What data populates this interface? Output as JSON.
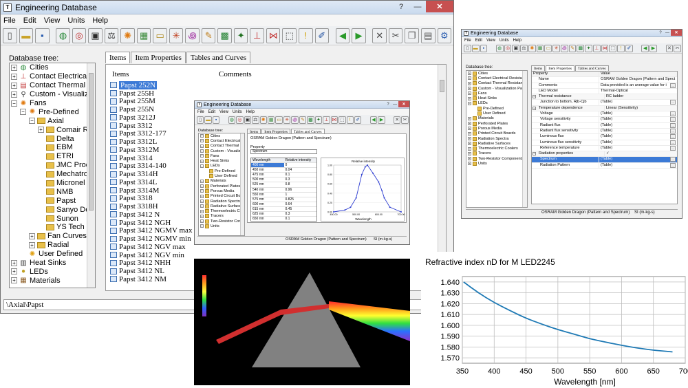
{
  "app": {
    "title": "Engineering Database",
    "menu": [
      "File",
      "Edit",
      "View",
      "Units",
      "Help"
    ],
    "window_controls": [
      "?",
      "—",
      "✕"
    ],
    "toolbar_icons": [
      "new-icon",
      "folder-icon",
      "save-icon",
      "globe-icon",
      "target-icon",
      "screen-icon",
      "scale-icon",
      "gear-icon",
      "grid-icon",
      "plate-icon",
      "network-icon",
      "spiral-icon",
      "tracer-icon",
      "pcb-icon",
      "tree-icon",
      "resistor-icon",
      "wing-icon",
      "chart-icon",
      "warning-icon",
      "edit-icon",
      "arrow-left-icon",
      "arrow-right-icon",
      "cross-icon",
      "scissors-icon",
      "copy-icon",
      "paste-icon",
      "settings-icon"
    ]
  },
  "main_window": {
    "tree_label": "Database tree:",
    "tabs": [
      "Items",
      "Item Properties",
      "Tables and Curves"
    ],
    "active_tab": 0,
    "tree": [
      {
        "label": "Cities",
        "level": 0,
        "exp": "+",
        "icon": "globe-icon"
      },
      {
        "label": "Contact Electrical Resis",
        "level": 0,
        "exp": "+",
        "icon": "contact-electrical-icon"
      },
      {
        "label": "Contact Thermal Resist",
        "level": 0,
        "exp": "+",
        "icon": "contact-thermal-icon"
      },
      {
        "label": "Custom - Visualization P",
        "level": 0,
        "exp": "+",
        "icon": "visualization-icon"
      },
      {
        "label": "Fans",
        "level": 0,
        "exp": "−",
        "icon": "fan-icon"
      },
      {
        "label": "Pre-Defined",
        "level": 1,
        "exp": "−",
        "icon": "predefined-icon"
      },
      {
        "label": "Axial",
        "level": 2,
        "exp": "−",
        "icon": "folder-icon"
      },
      {
        "label": "Comair Rot",
        "level": 3,
        "exp": "+",
        "icon": "folder-icon"
      },
      {
        "label": "Delta",
        "level": 3,
        "exp": "",
        "icon": "folder-icon"
      },
      {
        "label": "EBM",
        "level": 3,
        "exp": "",
        "icon": "folder-icon"
      },
      {
        "label": "ETRI",
        "level": 3,
        "exp": "",
        "icon": "folder-icon"
      },
      {
        "label": "JMC Produ",
        "level": 3,
        "exp": "",
        "icon": "folder-icon"
      },
      {
        "label": "Mechatroni",
        "level": 3,
        "exp": "",
        "icon": "folder-icon"
      },
      {
        "label": "Micronel",
        "level": 3,
        "exp": "",
        "icon": "folder-icon"
      },
      {
        "label": "NMB",
        "level": 3,
        "exp": "",
        "icon": "folder-icon"
      },
      {
        "label": "Papst",
        "level": 3,
        "exp": "",
        "icon": "folder-icon"
      },
      {
        "label": "Sanyo Den",
        "level": 3,
        "exp": "",
        "icon": "folder-icon"
      },
      {
        "label": "Sunon",
        "level": 3,
        "exp": "",
        "icon": "folder-icon"
      },
      {
        "label": "YS Tech U",
        "level": 3,
        "exp": "",
        "icon": "folder-icon"
      },
      {
        "label": "Fan Curves",
        "level": 2,
        "exp": "+",
        "icon": "folder-icon"
      },
      {
        "label": "Radial",
        "level": 2,
        "exp": "+",
        "icon": "folder-icon"
      },
      {
        "label": "User Defined",
        "level": 1,
        "exp": "",
        "icon": "user-defined-icon"
      },
      {
        "label": "Heat Sinks",
        "level": 0,
        "exp": "+",
        "icon": "heatsink-icon"
      },
      {
        "label": "LEDs",
        "level": 0,
        "exp": "+",
        "icon": "led-icon"
      },
      {
        "label": "Materials",
        "level": 0,
        "exp": "+",
        "icon": "materials-icon"
      }
    ],
    "list_headers": [
      "Items",
      "Comments"
    ],
    "items": [
      "Papst 252N",
      "Papst 255H",
      "Papst 255M",
      "Papst 255N",
      "Papst 3212J",
      "Papst 3312",
      "Papst 3312-177",
      "Papst 3312L",
      "Papst 3312M",
      "Papst 3314",
      "Papst 3314-140",
      "Papst 3314H",
      "Papst 3314L",
      "Papst 3314M",
      "Papst 3318",
      "Papst 3318H",
      "Papst 3412 N",
      "Papst 3412 NGH",
      "Papst 3412 NGMV max",
      "Papst 3412 NGMV min",
      "Papst 3412 NGV max",
      "Papst 3412 NGV min",
      "Papst 3412 NHH",
      "Papst 3412 NL",
      "Papst 3412 NM"
    ],
    "selected_item": 0,
    "status": "\\Axial\\Papst"
  },
  "tables_window": {
    "tree_label": "Database tree:",
    "tabs": [
      "Items",
      "Item Properties",
      "Tables and Curves"
    ],
    "active_tab": 2,
    "tree": [
      {
        "label": "Cities",
        "level": 0,
        "exp": "+"
      },
      {
        "label": "Contact Electrical Resistance",
        "level": 0,
        "exp": "+"
      },
      {
        "label": "Contact Thermal Resistance",
        "level": 0,
        "exp": "+"
      },
      {
        "label": "Custom - Visualization Para",
        "level": 0,
        "exp": "+"
      },
      {
        "label": "Fans",
        "level": 0,
        "exp": "+"
      },
      {
        "label": "Heat Sinks",
        "level": 0,
        "exp": "+"
      },
      {
        "label": "LEDs",
        "level": 0,
        "exp": "−"
      },
      {
        "label": "Pre-Defined",
        "level": 1,
        "exp": ""
      },
      {
        "label": "User Defined",
        "level": 1,
        "exp": ""
      },
      {
        "label": "Materials",
        "level": 0,
        "exp": "+"
      },
      {
        "label": "Perforated Plates",
        "level": 0,
        "exp": "+"
      },
      {
        "label": "Porous Media",
        "level": 0,
        "exp": "+"
      },
      {
        "label": "Printed Circuit Boards",
        "level": 0,
        "exp": "+"
      },
      {
        "label": "Radiation Spectra",
        "level": 0,
        "exp": "+"
      },
      {
        "label": "Radiative Surfaces",
        "level": 0,
        "exp": "+"
      },
      {
        "label": "Thermoelectric Coolers",
        "level": 0,
        "exp": "+"
      },
      {
        "label": "Tracers",
        "level": 0,
        "exp": "+"
      },
      {
        "label": "Two-Resistor Components",
        "level": 0,
        "exp": "+"
      },
      {
        "label": "Units",
        "level": 0,
        "exp": "+"
      }
    ],
    "panel_title": "OSRAM Golden Dragon (Pattern and Spectrum)",
    "property_label": "Property",
    "property_value": "Spectrum",
    "table_headers": [
      "Wavelength",
      "Relative intensity"
    ],
    "table_rows": [
      [
        "400 nm",
        "0"
      ],
      [
        "450 nm",
        "0.04"
      ],
      [
        "475 nm",
        "0.1"
      ],
      [
        "500 nm",
        "0.3"
      ],
      [
        "525 nm",
        "0.8"
      ],
      [
        "540 nm",
        "0.96"
      ],
      [
        "550 nm",
        "1"
      ],
      [
        "575 nm",
        "0.825"
      ],
      [
        "600 nm",
        "0.64"
      ],
      [
        "615 nm",
        "0.45"
      ],
      [
        "625 nm",
        "0.3"
      ],
      [
        "650 nm",
        "0.1"
      ],
      [
        "700 nm",
        "0"
      ]
    ],
    "selected_row": 0,
    "chart_title": "Relative intensity",
    "chart_xlabel": "Wavelength",
    "chart_yticks": [
      "1.00",
      "0.80",
      "0.60",
      "0.40",
      "0.20",
      "0.00"
    ],
    "chart_xticks": [
      "400.00",
      "500.00",
      "600.00",
      "700.00"
    ],
    "status_name": "OSRAM Golden Dragon (Pattern and Spectrum)",
    "status_units": "SI (m-kg-s)"
  },
  "props_window": {
    "tree_label": "Database tree:",
    "tabs": [
      "Items",
      "Item Properties",
      "Tables and Curves"
    ],
    "active_tab": 1,
    "tree": [
      {
        "label": "Cities",
        "level": 0,
        "exp": "+"
      },
      {
        "label": "Contact Electrical Resistance",
        "level": 0,
        "exp": "+"
      },
      {
        "label": "Contact Thermal Resistance",
        "level": 0,
        "exp": "+"
      },
      {
        "label": "Custom - Visualization Para",
        "level": 0,
        "exp": "+"
      },
      {
        "label": "Fans",
        "level": 0,
        "exp": "+"
      },
      {
        "label": "Heat Sinks",
        "level": 0,
        "exp": "+"
      },
      {
        "label": "LEDs",
        "level": 0,
        "exp": "−"
      },
      {
        "label": "Pre-Defined",
        "level": 1,
        "exp": ""
      },
      {
        "label": "User Defined",
        "level": 1,
        "exp": ""
      },
      {
        "label": "Materials",
        "level": 0,
        "exp": "+"
      },
      {
        "label": "Perforated Plates",
        "level": 0,
        "exp": "+"
      },
      {
        "label": "Porous Media",
        "level": 0,
        "exp": "+"
      },
      {
        "label": "Printed Circuit Boards",
        "level": 0,
        "exp": "+"
      },
      {
        "label": "Radiation Spectra",
        "level": 0,
        "exp": "+"
      },
      {
        "label": "Radiative Surfaces",
        "level": 0,
        "exp": "+"
      },
      {
        "label": "Thermoelectric Coolers",
        "level": 0,
        "exp": "+"
      },
      {
        "label": "Tracers",
        "level": 0,
        "exp": "+"
      },
      {
        "label": "Two-Resistor Components",
        "level": 0,
        "exp": "+"
      },
      {
        "label": "Units",
        "level": 0,
        "exp": "+"
      }
    ],
    "headers": [
      "Property",
      "Value"
    ],
    "rows": [
      {
        "name": "Name",
        "value": "OSRAM Golden Dragon (Pattern and Spect",
        "kind": "plain",
        "dots": false
      },
      {
        "name": "Comments",
        "value": "Data provided is an average value for i",
        "kind": "plain",
        "dots": true
      },
      {
        "name": "LED Model",
        "value": "Thermal-Optical",
        "kind": "plain",
        "dots": false
      },
      {
        "name": "Thermal resistance",
        "value": "RC ladder",
        "kind": "cat",
        "dots": false
      },
      {
        "name": "Junction to bottom, Rjb-Cjb",
        "value": "(Table)",
        "kind": "sub",
        "dots": true
      },
      {
        "name": "Temperature dependence",
        "value": "Linear (Sensitivity)",
        "kind": "cat",
        "dots": false
      },
      {
        "name": "Voltage",
        "value": "(Table)",
        "kind": "sub",
        "dots": true
      },
      {
        "name": "Voltage sensitivity",
        "value": "(Table)",
        "kind": "sub",
        "dots": true
      },
      {
        "name": "Radiant flux",
        "value": "(Table)",
        "kind": "sub",
        "dots": true
      },
      {
        "name": "Radiant flux sensitivity",
        "value": "(Table)",
        "kind": "sub",
        "dots": true
      },
      {
        "name": "Luminous flux",
        "value": "(Table)",
        "kind": "sub",
        "dots": true
      },
      {
        "name": "Luminous flux sensitivity",
        "value": "(Table)",
        "kind": "sub",
        "dots": true
      },
      {
        "name": "Reference temperature",
        "value": "(Table)",
        "kind": "sub",
        "dots": true
      },
      {
        "name": "Radiation properties",
        "value": "✓",
        "kind": "cat",
        "dots": false
      },
      {
        "name": "Spectrum",
        "value": "(Table)",
        "kind": "sel",
        "dots": true
      },
      {
        "name": "Radiation Pattern",
        "value": "(Table)",
        "kind": "sub",
        "dots": true
      }
    ],
    "status_name": "OSRAM Golden Dragon (Pattern and Spectrum)",
    "status_units": "SI (m-kg-s)"
  },
  "chart_data": {
    "type": "line",
    "title": "Refractive index nD for M LED2245",
    "xlabel": "Wavelength [nm]",
    "ylabel": "",
    "xlim": [
      350,
      700
    ],
    "ylim": [
      1.565,
      1.645
    ],
    "xticks": [
      350,
      400,
      450,
      500,
      550,
      600,
      650,
      700
    ],
    "yticks": [
      1.57,
      1.58,
      1.59,
      1.6,
      1.61,
      1.62,
      1.63,
      1.64
    ],
    "grid": true,
    "color": "#1f7ab5",
    "x": [
      352,
      375,
      400,
      425,
      450,
      475,
      500,
      525,
      550,
      575,
      600,
      625,
      650,
      680
    ],
    "y": [
      1.64,
      1.63,
      1.621,
      1.6135,
      1.6065,
      1.601,
      1.596,
      1.592,
      1.5875,
      1.5845,
      1.5815,
      1.579,
      1.577,
      1.5755
    ]
  }
}
